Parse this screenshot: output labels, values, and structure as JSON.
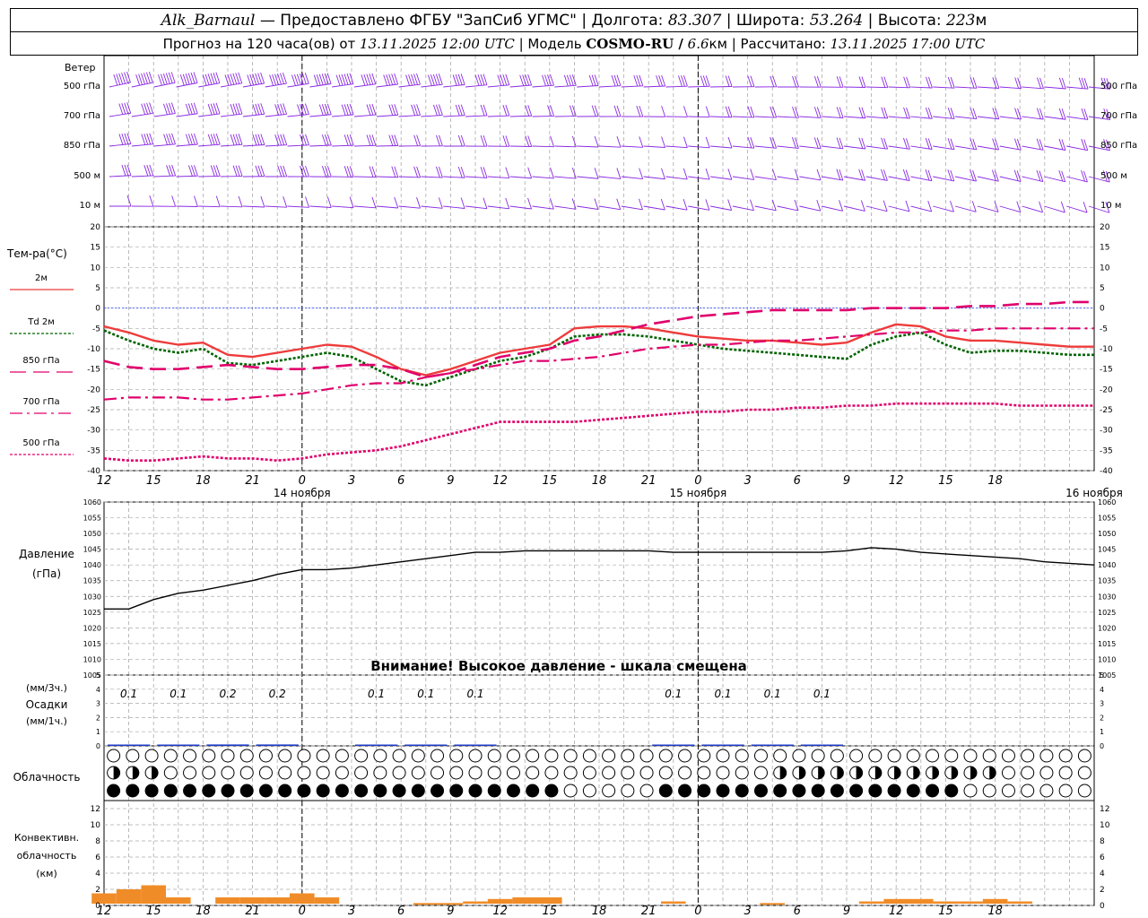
{
  "header": {
    "station": "Alk_Barnaul",
    "provider": "— Предоставлено ФГБУ \"ЗапСиб УГМС\"",
    "lon_label": "Долгота:",
    "lon_value": "83.307",
    "lat_label": "Широта:",
    "lat_value": "53.264",
    "alt_label": "Высота:",
    "alt_value": "223",
    "alt_unit": "м",
    "forecast_label": "Прогноз на 120 часа(ов) от",
    "forecast_time": "13.11.2025 12:00 UTC",
    "model_label": "Модель",
    "model_name": "COSMO-RU /",
    "model_res": "6.6",
    "model_res_unit": "км",
    "calc_label": "Рассчитано:",
    "calc_time": "13.11.2025 17:00 UTC"
  },
  "colors": {
    "wind": "#8a2be2",
    "t2m": "#ee3b3b",
    "td2m": "#006400",
    "t850": "#e0006c",
    "t700": "#e0006c",
    "t500": "#e0006c",
    "pressure": "#000000",
    "precip": "#1e3cc8",
    "convective": "#f08c28",
    "grid": "#aaaaaa"
  },
  "time_axis": {
    "hour_labels": [
      "12",
      "15",
      "18",
      "21",
      "0",
      "3",
      "6",
      "9",
      "12",
      "15",
      "18",
      "21",
      "0",
      "3",
      "6",
      "9",
      "12",
      "15",
      "18"
    ],
    "day_labels": [
      {
        "text": "14 ноября",
        "at": 4
      },
      {
        "text": "15 ноября",
        "at": 12
      },
      {
        "text": "16 ноября",
        "at": 20
      }
    ],
    "midnight_indices": [
      4,
      12
    ]
  },
  "wind_panel": {
    "title": "Ветер",
    "levels": [
      "500 гПа",
      "700 гПа",
      "850 гПа",
      "500 м",
      "10  м"
    ],
    "level_speed_ms": [
      [
        28,
        28,
        29,
        30,
        30,
        30,
        31,
        31,
        30,
        29,
        28,
        27,
        26,
        25,
        24,
        22,
        21,
        20,
        19,
        18,
        18,
        17,
        16,
        16,
        15,
        14,
        13,
        12,
        11,
        10,
        10,
        9,
        9,
        8,
        8,
        9,
        9,
        10,
        10,
        11,
        11,
        12,
        12,
        13,
        13
      ],
      [
        20,
        20,
        21,
        21,
        22,
        22,
        22,
        21,
        20,
        19,
        18,
        17,
        16,
        15,
        14,
        13,
        12,
        11,
        10,
        9,
        9,
        8,
        8,
        8,
        7,
        7,
        7,
        8,
        8,
        8,
        9,
        9,
        10,
        10,
        10,
        11,
        11,
        11,
        12,
        12,
        12,
        12,
        12,
        12,
        12
      ],
      [
        18,
        18,
        18,
        19,
        19,
        19,
        19,
        18,
        17,
        16,
        15,
        14,
        13,
        12,
        11,
        10,
        9,
        8,
        8,
        7,
        7,
        7,
        6,
        6,
        6,
        7,
        7,
        7,
        8,
        8,
        8,
        8,
        9,
        9,
        9,
        10,
        10,
        10,
        10,
        10,
        10,
        10,
        10,
        10,
        10
      ],
      [
        16,
        16,
        16,
        17,
        17,
        17,
        17,
        16,
        15,
        14,
        13,
        12,
        11,
        10,
        9,
        8,
        8,
        7,
        7,
        6,
        6,
        5,
        5,
        5,
        5,
        6,
        6,
        6,
        7,
        7,
        7,
        7,
        8,
        8,
        8,
        8,
        8,
        9,
        9,
        9,
        9,
        9,
        9,
        9,
        9
      ],
      [
        7,
        7,
        7,
        7,
        7,
        6,
        6,
        6,
        6,
        5,
        5,
        5,
        4,
        4,
        4,
        3,
        3,
        3,
        3,
        3,
        3,
        3,
        3,
        3,
        3,
        3,
        3,
        3,
        3,
        4,
        4,
        4,
        4,
        4,
        4,
        4,
        4,
        4,
        4,
        4,
        4,
        4,
        4,
        4,
        4
      ]
    ]
  },
  "temp_panel": {
    "title": "Тем-ра(°C)",
    "y_ticks": [
      20,
      15,
      10,
      5,
      0,
      -5,
      -10,
      -15,
      -20,
      -25,
      -30,
      -35,
      -40
    ],
    "legend": [
      {
        "label": "2м",
        "series": "t2m"
      },
      {
        "label": "Td  2м",
        "series": "td2m"
      },
      {
        "label": "850 гПа",
        "series": "t850"
      },
      {
        "label": "700 гПа",
        "series": "t700"
      },
      {
        "label": "500 гПа",
        "series": "t500"
      }
    ]
  },
  "pressure_panel": {
    "title": "Давление",
    "unit": "(гПа)",
    "y_ticks": [
      1060,
      1055,
      1050,
      1045,
      1040,
      1035,
      1030,
      1025,
      1020,
      1015,
      1010,
      1005
    ],
    "warning": "Внимание! Высокое давление - шкала смещена"
  },
  "precip_panel": {
    "unit3h": "(мм/3ч.)",
    "title": "Осадки",
    "unit1h": "(мм/1ч.)",
    "y_ticks": [
      5,
      4,
      3,
      2,
      1,
      0
    ],
    "labels": [
      {
        "i": 0.5,
        "text": "0.1"
      },
      {
        "i": 1.5,
        "text": "0.1"
      },
      {
        "i": 2.5,
        "text": "0.2"
      },
      {
        "i": 3.5,
        "text": "0.2"
      },
      {
        "i": 5.5,
        "text": "0.1"
      },
      {
        "i": 6.5,
        "text": "0.1"
      },
      {
        "i": 7.5,
        "text": "0.1"
      },
      {
        "i": 11.5,
        "text": "0.1"
      },
      {
        "i": 12.5,
        "text": "0.1"
      },
      {
        "i": 13.5,
        "text": "0.1"
      },
      {
        "i": 14.5,
        "text": "0.1"
      }
    ]
  },
  "cloud_panel": {
    "title": "Облачность"
  },
  "conv_panel": {
    "title1": "Конвективн.",
    "title2": "облачность",
    "unit": "(км)",
    "y_ticks": [
      12,
      10,
      8,
      6,
      4,
      2,
      0
    ]
  },
  "chart_data": {
    "type": "line",
    "x_hours": [
      0,
      3,
      6,
      9,
      12,
      15,
      18,
      21,
      24,
      27,
      30,
      33,
      36,
      39,
      42,
      45,
      48,
      51,
      54,
      57,
      60,
      63,
      66,
      69,
      72,
      75,
      78,
      81,
      84,
      87,
      90,
      93,
      96,
      99,
      102,
      105,
      108,
      111,
      114,
      117,
      120
    ],
    "series": [
      {
        "name": "2м",
        "key": "t2m",
        "values": [
          -4.5,
          -6,
          -8,
          -9,
          -8.5,
          -11.5,
          -12,
          -11,
          -10,
          -9,
          -9.5,
          -12,
          -15,
          -16.5,
          -15,
          -13,
          -11,
          -10,
          -9,
          -5,
          -4.5,
          -4.5,
          -5,
          -6,
          -7,
          -7.5,
          -8,
          -8,
          -8.5,
          -9,
          -8.5,
          -6,
          -4,
          -4.5,
          -7,
          -8,
          -8,
          -8.5,
          -9,
          -9.5,
          -9.5
        ]
      },
      {
        "name": "Td  2м",
        "key": "td2m",
        "values": [
          -5.5,
          -8,
          -10,
          -11,
          -10,
          -13.5,
          -14,
          -13,
          -12,
          -11,
          -12,
          -15,
          -18,
          -19,
          -17,
          -15,
          -13,
          -12,
          -10,
          -7,
          -6.5,
          -6.5,
          -7,
          -8,
          -9,
          -10,
          -10.5,
          -11,
          -11.5,
          -12,
          -12.5,
          -9,
          -7,
          -6,
          -9,
          -11,
          -10.5,
          -10.5,
          -11,
          -11.5,
          -11.5
        ]
      },
      {
        "name": "850 гПа",
        "key": "t850",
        "values": [
          -13,
          -14.5,
          -15,
          -15,
          -14.5,
          -14,
          -14.5,
          -15,
          -15,
          -14.5,
          -14,
          -14,
          -15,
          -17,
          -16,
          -14,
          -12,
          -11,
          -10,
          -8,
          -7,
          -5.5,
          -4,
          -3,
          -2,
          -1.5,
          -1,
          -0.5,
          -0.5,
          -0.5,
          -0.5,
          0,
          0,
          0,
          0,
          0.5,
          0.5,
          1,
          1,
          1.5,
          1.5
        ]
      },
      {
        "name": "700 гПа",
        "key": "t700",
        "values": [
          -22.5,
          -22,
          -22,
          -22,
          -22.5,
          -22.5,
          -22,
          -21.5,
          -21,
          -20,
          -19,
          -18.5,
          -18.5,
          -17,
          -16,
          -15,
          -14,
          -13,
          -13,
          -12.5,
          -12,
          -11,
          -10,
          -9.5,
          -9,
          -9,
          -8.5,
          -8,
          -8,
          -7.5,
          -7,
          -6.5,
          -6,
          -6,
          -5.5,
          -5.5,
          -5,
          -5,
          -5,
          -5,
          -5
        ]
      },
      {
        "name": "500 гПа",
        "key": "t500",
        "values": [
          -37,
          -37.5,
          -37.5,
          -37,
          -36.5,
          -37,
          -37,
          -37.5,
          -37,
          -36,
          -35.5,
          -35,
          -34,
          -32.5,
          -31,
          -29.5,
          -28,
          -28,
          -28,
          -28,
          -27.5,
          -27,
          -26.5,
          -26,
          -25.5,
          -25.5,
          -25,
          -25,
          -24.5,
          -24.5,
          -24,
          -24,
          -23.5,
          -23.5,
          -23.5,
          -23.5,
          -23.5,
          -24,
          -24,
          -24,
          -24
        ]
      },
      {
        "name": "Давление",
        "key": "pressure",
        "values": [
          1026,
          1026,
          1029,
          1031,
          1032,
          1033.5,
          1035,
          1037,
          1038.5,
          1038.5,
          1039,
          1040,
          1041,
          1042,
          1043,
          1044,
          1044,
          1044.5,
          1044.5,
          1044.5,
          1044.5,
          1044.5,
          1044.5,
          1044,
          1044,
          1044,
          1044,
          1044,
          1044,
          1044,
          1044.5,
          1045.5,
          1045,
          1044,
          1043.5,
          1043,
          1042.5,
          1042,
          1041,
          1040.5,
          1040
        ]
      }
    ],
    "precip_3h_mm": [
      0.1,
      0.1,
      0.2,
      0.2,
      0.0,
      0.1,
      0.1,
      0.1,
      0.0,
      0.0,
      0.0,
      0.1,
      0.1,
      0.1,
      0.1,
      0.0,
      0.0,
      0.0,
      0.0,
      0.0
    ],
    "convective_cloud_km": [
      1.5,
      2,
      2.5,
      1,
      0,
      1,
      1,
      1,
      1.5,
      1,
      0,
      0,
      0,
      0.3,
      0.3,
      0.5,
      0.8,
      1,
      1,
      0,
      0,
      0,
      0,
      0.5,
      0,
      0,
      0,
      0.3,
      0,
      0,
      0,
      0.5,
      0.8,
      0.8,
      0.5,
      0.5,
      0.8,
      0.5,
      0,
      0,
      0
    ],
    "ylim_temperature": [
      -40,
      20
    ],
    "ylim_pressure": [
      1005,
      1060
    ],
    "ylim_precip": [
      0,
      5
    ],
    "ylim_convective": [
      0,
      13
    ]
  }
}
